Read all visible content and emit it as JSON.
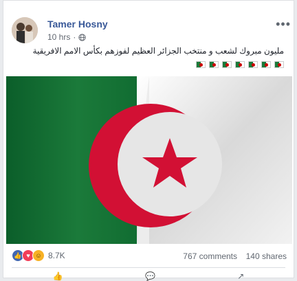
{
  "post": {
    "author": "Tamer Hosny",
    "time": "10 hrs",
    "privacy_icon": "globe-icon",
    "more_label": "•••",
    "text": "مليون مبروك لشعب و منتخب الجزائر العظيم لفوزهم بكأس الامم الافريقية",
    "flag_emoji_count": 7
  },
  "stats": {
    "reaction_icons": [
      "like-icon",
      "love-icon",
      "haha-icon"
    ],
    "reaction_count": "8.7K",
    "comments": "767 comments",
    "shares": "140 shares"
  },
  "colors": {
    "author": "#385898",
    "flag_green": "#1b7a3a",
    "flag_red": "#d21034",
    "like": "#4267b2",
    "love": "#f33e58",
    "haha": "#f7b125"
  }
}
